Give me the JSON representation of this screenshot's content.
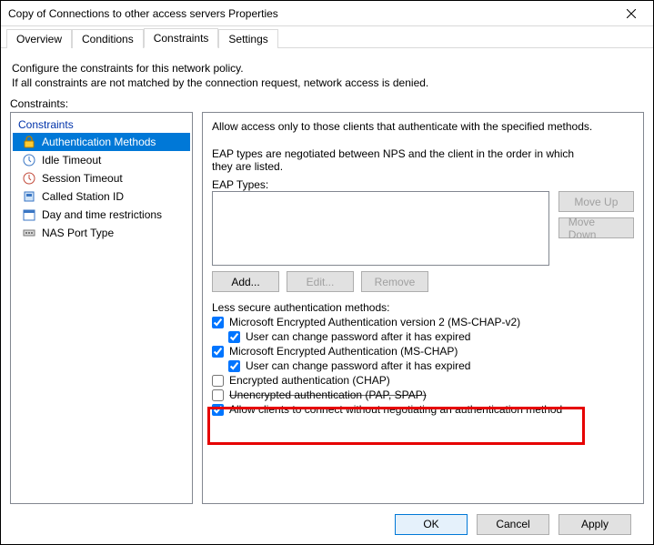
{
  "window": {
    "title": "Copy of Connections to other access servers Properties"
  },
  "tabs": [
    "Overview",
    "Conditions",
    "Constraints",
    "Settings"
  ],
  "active_tab": 2,
  "description_l1": "Configure the constraints for this network policy.",
  "description_l2": "If all constraints are not matched by the connection request, network access is denied.",
  "left": {
    "label": "Constraints:",
    "header": "Constraints",
    "items": [
      "Authentication Methods",
      "Idle Timeout",
      "Session Timeout",
      "Called Station ID",
      "Day and time restrictions",
      "NAS Port Type"
    ],
    "selected": 0
  },
  "right": {
    "intro": "Allow access only to those clients that authenticate with the specified methods.",
    "eap_note": "EAP types are negotiated between NPS and the client in the order in which they are listed.",
    "eap_label": "EAP Types:",
    "move_up": "Move Up",
    "move_down": "Move Down",
    "add": "Add...",
    "edit": "Edit...",
    "remove": "Remove",
    "less_secure": "Less secure authentication methods:",
    "opts": [
      {
        "label": "Microsoft Encrypted Authentication version 2 (MS-CHAP-v2)",
        "checked": true
      },
      {
        "label": "User can change password after it has expired",
        "checked": true,
        "indent": true
      },
      {
        "label": "Microsoft Encrypted Authentication (MS-CHAP)",
        "checked": true
      },
      {
        "label": "User can change password after it has expired",
        "checked": true,
        "indent": true
      },
      {
        "label": "Encrypted authentication (CHAP)",
        "checked": false
      },
      {
        "label": "Unencrypted authentication (PAP, SPAP)",
        "checked": false,
        "struck": true
      },
      {
        "label": "Allow clients to connect without negotiating an authentication method",
        "checked": true
      }
    ]
  },
  "footer": {
    "ok": "OK",
    "cancel": "Cancel",
    "apply": "Apply"
  }
}
